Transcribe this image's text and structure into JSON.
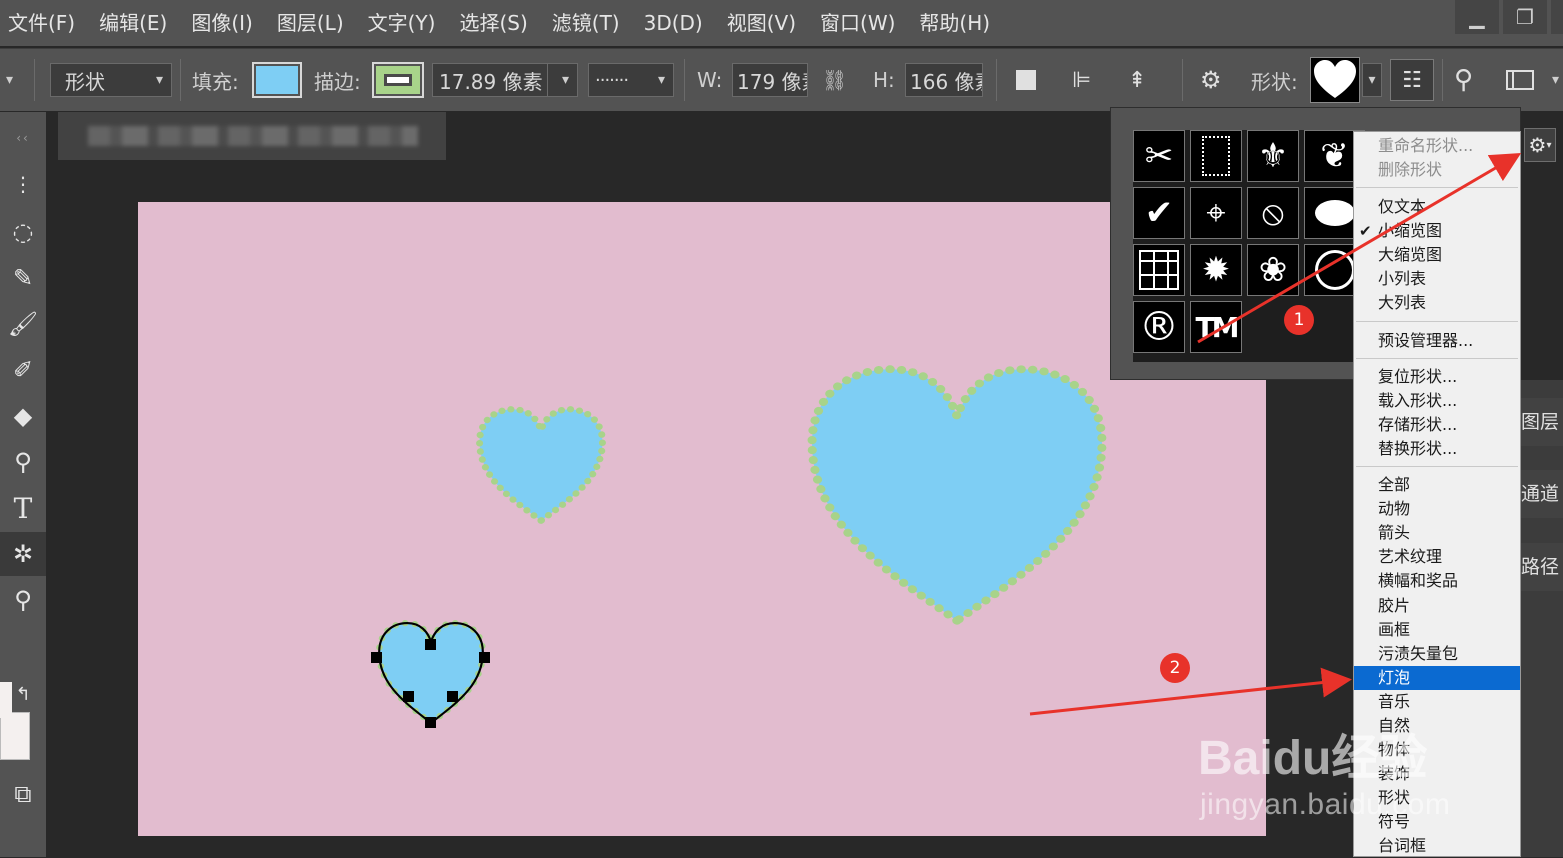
{
  "menubar": {
    "items": [
      "文件(F)",
      "编辑(E)",
      "图像(I)",
      "图层(L)",
      "文字(Y)",
      "选择(S)",
      "滤镜(T)",
      "3D(D)",
      "视图(V)",
      "窗口(W)",
      "帮助(H)"
    ]
  },
  "options": {
    "mode_value": "形状",
    "fill_label": "填充:",
    "fill_color": "#7ecef4",
    "stroke_label": "描边:",
    "stroke_color": "#a8d38a",
    "stroke_width": "17.89 像素",
    "stroke_style": "·······",
    "width_label": "W:",
    "width_value": "179 像素",
    "height_label": "H:",
    "height_value": "166 像素",
    "shape_label": "形状:"
  },
  "colors": {
    "canvas_bg": "#e2bccf",
    "heart_fill": "#7ecef4",
    "heart_dots": "#a8d38a",
    "selection_blue": "#0b6ad1",
    "annotation_red": "#e8322a"
  },
  "shape_picker": {
    "cells": [
      "scissors-icon",
      "frame-icon",
      "fleur-de-lis-icon",
      "heart-ornament-icon",
      "checkmark-icon",
      "target-icon",
      "no-sign-icon",
      "speech-bubble-icon",
      "grid-icon",
      "starburst-icon",
      "paw-icon",
      "circle-icon",
      "registered-icon",
      "trademark-icon"
    ],
    "registered_glyph": "®",
    "trademark_glyph": "TM"
  },
  "context_menu": {
    "items": [
      {
        "label": "重命名形状...",
        "state": "disabled"
      },
      {
        "label": "删除形状",
        "state": "disabled"
      },
      {
        "label": "仅文本",
        "state": "normal"
      },
      {
        "label": "小缩览图",
        "state": "checked"
      },
      {
        "label": "大缩览图",
        "state": "normal"
      },
      {
        "label": "小列表",
        "state": "normal"
      },
      {
        "label": "大列表",
        "state": "normal"
      },
      {
        "label": "预设管理器...",
        "state": "normal"
      },
      {
        "label": "复位形状...",
        "state": "normal"
      },
      {
        "label": "载入形状...",
        "state": "normal"
      },
      {
        "label": "存储形状...",
        "state": "normal"
      },
      {
        "label": "替换形状...",
        "state": "normal"
      },
      {
        "label": "全部",
        "state": "normal"
      },
      {
        "label": "动物",
        "state": "normal"
      },
      {
        "label": "箭头",
        "state": "normal"
      },
      {
        "label": "艺术纹理",
        "state": "normal"
      },
      {
        "label": "横幅和奖品",
        "state": "normal"
      },
      {
        "label": "胶片",
        "state": "normal"
      },
      {
        "label": "画框",
        "state": "normal"
      },
      {
        "label": "污渍矢量包",
        "state": "normal"
      },
      {
        "label": "灯泡",
        "state": "selected"
      },
      {
        "label": "音乐",
        "state": "normal"
      },
      {
        "label": "自然",
        "state": "normal"
      },
      {
        "label": "物体",
        "state": "normal"
      },
      {
        "label": "装饰",
        "state": "normal"
      },
      {
        "label": "形状",
        "state": "normal"
      },
      {
        "label": "符号",
        "state": "normal"
      },
      {
        "label": "台词框",
        "state": "normal"
      }
    ]
  },
  "panels": {
    "layers": "图层",
    "channels": "通道",
    "paths": "路径"
  },
  "annotations": {
    "badge_1": "1",
    "badge_2": "2"
  },
  "watermark": {
    "logo": "Baidu经验",
    "url": "jingyan.baidu.com"
  }
}
